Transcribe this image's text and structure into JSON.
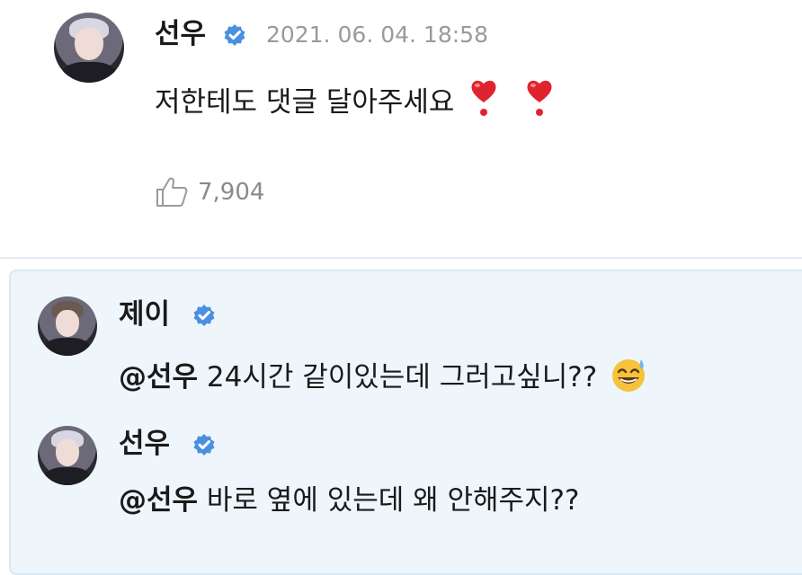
{
  "comment": {
    "author": "선우",
    "timestamp": "2021. 06. 04. 18:58",
    "text": "저한테도 댓글 달아주세요",
    "likes": "7,904",
    "icons": [
      "verified-badge-icon",
      "heart-emoji-icon",
      "heart-emoji-icon",
      "thumbs-up-icon"
    ]
  },
  "replies": [
    {
      "author": "제이",
      "mention": "@선우",
      "text": "24시간 같이있는데 그러고싶니??",
      "icons": [
        "verified-badge-icon",
        "sweat-smile-emoji-icon"
      ]
    },
    {
      "author": "선우",
      "mention": "@선우",
      "text": "바로 옆에 있는데 왜 안해주지??",
      "icons": [
        "verified-badge-icon"
      ]
    }
  ],
  "colors": {
    "verified": "#4a90e2",
    "reply_background": "#eef5fb",
    "muted_text": "#9a9a9a",
    "heart": "#e0242f"
  }
}
